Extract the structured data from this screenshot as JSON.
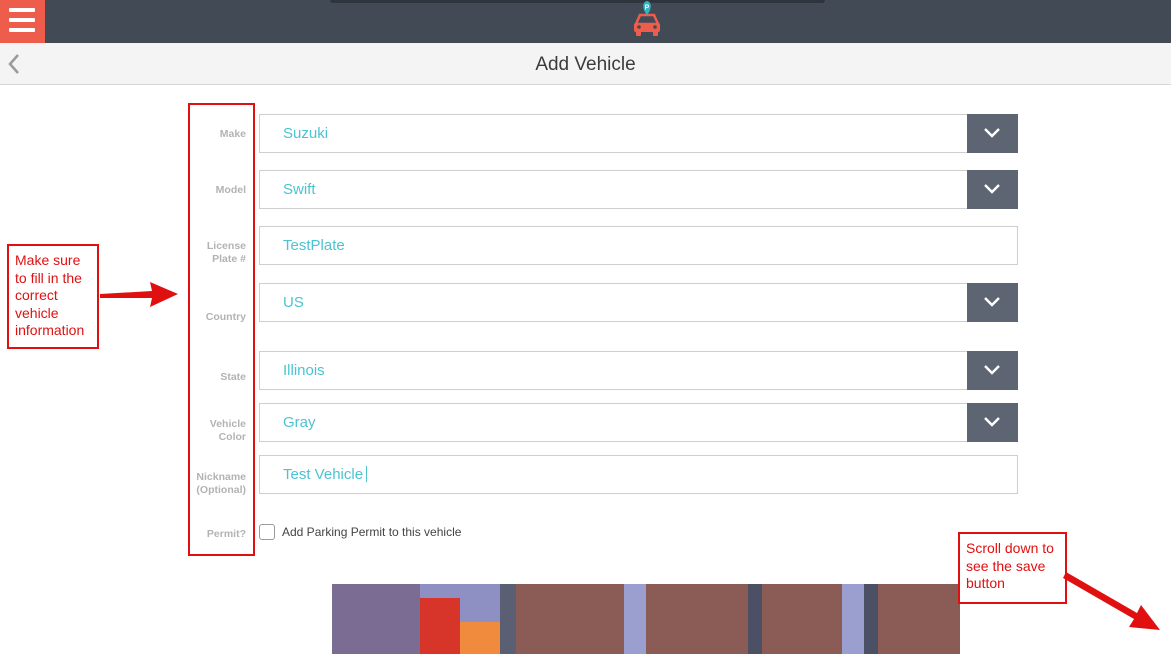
{
  "app": {
    "title": "Add Vehicle",
    "logo_icon": "parking-car-icon"
  },
  "form": {
    "make": {
      "label": "Make",
      "value": "Suzuki"
    },
    "model": {
      "label": "Model",
      "value": "Swift"
    },
    "license": {
      "label_line1": "License",
      "label_line2": "Plate #",
      "value": "TestPlate"
    },
    "country": {
      "label": "Country",
      "value": "US"
    },
    "state": {
      "label": "State",
      "value": "Illinois"
    },
    "color": {
      "label_line1": "Vehicle",
      "label_line2": "Color",
      "value": "Gray"
    },
    "nickname": {
      "label_line1": "Nickname",
      "label_line2": "(Optional)",
      "value": "Test Vehicle"
    },
    "permit": {
      "label": "Permit?",
      "checkbox_label": "Add Parking Permit to this vehicle",
      "checked": false
    }
  },
  "annotations": {
    "left_note_lines": [
      "Make sure",
      "to fill in the",
      "correct",
      "vehicle",
      "information"
    ],
    "right_note_lines": [
      "Scroll down to",
      "see the save",
      "button"
    ]
  },
  "colors": {
    "topbar": "#424a56",
    "menu": "#ee5d4c",
    "value_text": "#4cc3d1",
    "dropdown_button": "#5d6572",
    "annotation": "#e01010"
  }
}
